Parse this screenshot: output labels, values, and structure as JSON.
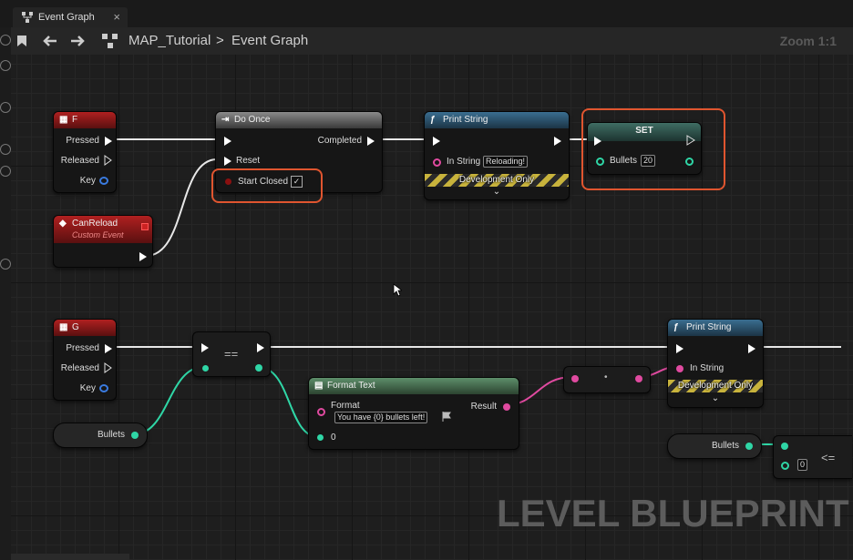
{
  "tab": {
    "title": "Event Graph",
    "close": "×"
  },
  "toolbar": {
    "project": "MAP_Tutorial",
    "separator": ">",
    "graph": "Event Graph",
    "zoom": "Zoom 1:1"
  },
  "nodes": {
    "key_f": {
      "title": "F",
      "pins": [
        "Pressed",
        "Released",
        "Key"
      ]
    },
    "do_once": {
      "title": "Do Once",
      "out": "Completed",
      "reset": "Reset",
      "start_closed": "Start Closed",
      "checkmark": "✓"
    },
    "print1": {
      "title": "Print String",
      "in_string": "In String",
      "value": "Reloading!",
      "dev": "Development Only"
    },
    "set": {
      "title": "SET",
      "pin": "Bullets",
      "value": "20"
    },
    "canreload": {
      "title": "CanReload",
      "subtitle": "Custom Event"
    },
    "key_g": {
      "title": "G",
      "pins": [
        "Pressed",
        "Released",
        "Key"
      ]
    },
    "equal": {
      "label": "=="
    },
    "format": {
      "title": "Format Text",
      "format_label": "Format",
      "format_value": "You have {0} bullets left!",
      "result": "Result",
      "arg": "0"
    },
    "reroute": {
      "label": "•"
    },
    "print2": {
      "title": "Print String",
      "in_string": "In String",
      "dev": "Development Only"
    },
    "bullets1": {
      "label": "Bullets"
    },
    "bullets2": {
      "label": "Bullets"
    },
    "compare": {
      "value": "0",
      "op": "<="
    }
  },
  "watermark": "LEVEL BLUEPRINT",
  "colors": {
    "exec": "#ffffff",
    "int": "#2fd6a6",
    "text": "#e04aa0",
    "bool": "#8b1010",
    "highlight": "#e0552f"
  }
}
